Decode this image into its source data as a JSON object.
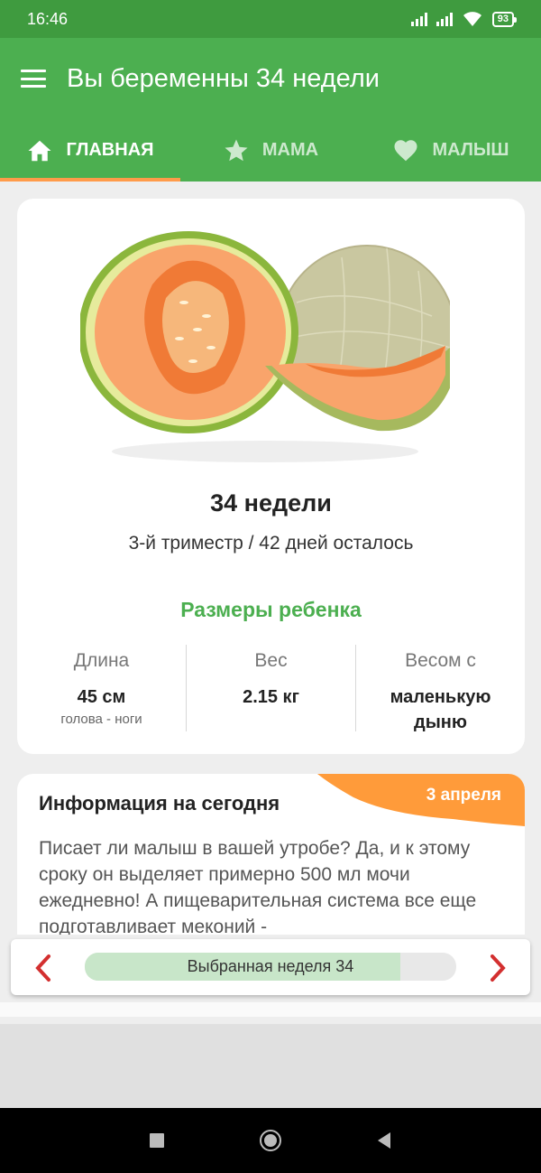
{
  "status_bar": {
    "time": "16:46",
    "battery": "93"
  },
  "app_bar": {
    "title": "Вы беременны 34 недели"
  },
  "tabs": [
    {
      "label": "ГЛАВНАЯ",
      "icon": "home-icon",
      "active": true
    },
    {
      "label": "МАМА",
      "icon": "star-icon",
      "active": false
    },
    {
      "label": "МАЛЫШ",
      "icon": "heart-icon",
      "active": false
    }
  ],
  "week_card": {
    "image": "cantaloupe-melon",
    "title": "34 недели",
    "subtitle": "3-й триместр / 42 дней осталось",
    "sizes_title": "Размеры ребенка",
    "stats": [
      {
        "label": "Длина",
        "value": "45 см",
        "note": "голова - ноги"
      },
      {
        "label": "Вес",
        "value": "2.15 кг",
        "note": ""
      },
      {
        "label": "Весом с",
        "value": "маленькую дыню",
        "note": ""
      }
    ]
  },
  "info_card": {
    "title": "Информация на сегодня",
    "date": "3 апреля",
    "text": "Писает ли малыш в вашей утробе? Да, и к этому сроку он выделяет примерно 500 мл мочи ежедневно! А пищеварительная система все еще подготавливает меконий -"
  },
  "week_selector": {
    "label": "Выбранная неделя 34",
    "progress_fraction": 0.85
  },
  "colors": {
    "status_bar": "#3f9b3f",
    "primary": "#4caf50",
    "accent": "#ff9b4a",
    "arrow": "#d32f2f"
  }
}
